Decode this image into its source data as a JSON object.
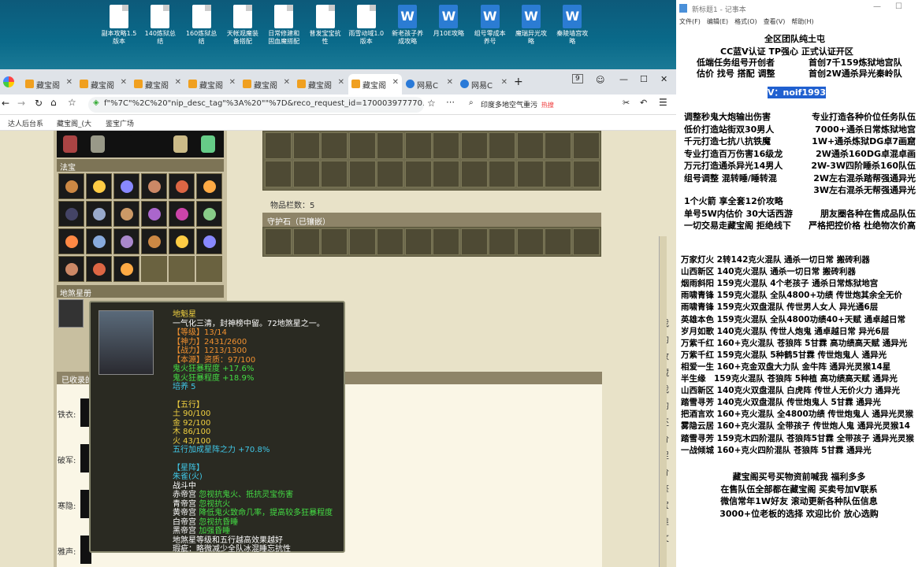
{
  "desktop": {
    "icons": [
      {
        "label": "副本攻略1.5版本",
        "type": "doc"
      },
      {
        "label": "140炼狱总结",
        "type": "doc"
      },
      {
        "label": "160炼狱总结",
        "type": "doc"
      },
      {
        "label": "天帐观魔装备搭配",
        "type": "doc"
      },
      {
        "label": "日常修建和固血魔搭配",
        "type": "doc"
      },
      {
        "label": "普发宝宝抗性",
        "type": "doc"
      },
      {
        "label": "雨雪动域1.0版本",
        "type": "doc"
      },
      {
        "label": "新老孩子养成攻略",
        "type": "word"
      },
      {
        "label": "月10E攻略",
        "type": "word"
      },
      {
        "label": "组号零成本养号",
        "type": "word"
      },
      {
        "label": "魔瑞异光攻略",
        "type": "word"
      },
      {
        "label": "秦陵墙宫攻略",
        "type": "word"
      }
    ]
  },
  "browser": {
    "tabs": [
      "藏宝阁",
      "藏宝阁",
      "藏宝阁",
      "藏宝阁",
      "藏宝阁",
      "藏宝阁",
      "藏宝阁",
      "网易C",
      "网易C"
    ],
    "tab_counter": "9",
    "url": "f\"%7C\"%2C%20\"nip_desc_tag\"%3A%20\"\"%7D&reco_request_id=1700039777701DS9mY",
    "search_placeholder": "印度多地空气重污",
    "search_badge": "热搜",
    "bookmarks": [
      "达人后台系",
      "藏宝阁_(大",
      "鉴宝广场"
    ]
  },
  "game": {
    "section_fabao": "法宝",
    "section_disha": "地煞星册",
    "section_collected": "已收录的",
    "item_count_label": "物品栏数：5",
    "guardian_label": "守护石（已镶嵌）",
    "side_labels": [
      "铁衣:",
      "破军:",
      "寒隐:",
      "雅声:"
    ],
    "right_sidebar_chars": [
      "我",
      "的",
      "收",
      "藏",
      "我",
      "的",
      "还",
      "价",
      "促",
      "价",
      "鉴",
      "宝",
      "推",
      "文"
    ]
  },
  "tooltip": {
    "name": "地魁星",
    "desc": "一气化三清，封神榜中留。72地煞星之一。",
    "level": "【等级】13/14",
    "shenli": "【神力】2431/2600",
    "zhanli": "【战力】1213/1300",
    "zizhi": "【本源】资质：97/100",
    "stat1": "鬼火狂暴程度 +17.6%",
    "stat2": "鬼火狂暴程度 +18.9%",
    "peiyang": "培养 5",
    "wuxing_title": "【五行】",
    "tu": "土 90/100",
    "jin": "金 92/100",
    "mu": "木 86/100",
    "huo": "火 43/100",
    "wuxing_bonus": "五行加成星阵之力 +70.8%",
    "xingzhen_title": "【星阵】",
    "xingzhen_name": "朱雀(火)",
    "zhandouzhong": "战斗中",
    "chidi_k": "赤帝宫",
    "chidi_v": "忽视抗鬼火、抵抗灵宝伤害",
    "qingdi_k": "青帝宫",
    "qingdi_v": "忽视抗火",
    "huangdi_k": "黄帝宫",
    "huangdi_v": "降低鬼火致命几率，提高较多狂暴程度",
    "baidi_k": "白帝宫",
    "baidi_v": "忽视抗昏睡",
    "heidi_k": "黑帝宫",
    "heidi_v": "加强昏睡",
    "note1": "地煞星等级和五行越高效果越好",
    "note2": "瑕疵：略微减少全队冰混睡忘抗性"
  },
  "notepad": {
    "title": "新标题1 - 记事本",
    "menu": [
      "文件(F)",
      "编辑(E)",
      "格式(O)",
      "查看(V)",
      "帮助(H)"
    ],
    "head": [
      "全区团队纯土屯",
      "CC蓝V认证 TP强心 正式认证开区",
      "低端任务组号开创者",
      "首创7千159炼狱地宫队",
      "估价 找号 搭配 调整",
      "首创2W通杀异光秦岭队"
    ],
    "contact": "V：noif1993",
    "services_left": [
      "调整秒鬼大炮输出伤害",
      "低价打造站街双30男人",
      "千元打造七抗八抗铁魔",
      "专业打造百万伤害16级龙",
      "万元打造通杀异光14男人",
      "组号调整 混转睡/睡转混"
    ],
    "services_right": [
      "专业打造各种价位任务队伍",
      "7000+通杀日常炼狱地宫",
      "1W+通杀炼狱DG卓7画窟",
      "2W通杀160DG卓混卓画",
      "2W-3W四阶睡杀160队伍",
      "2W左右混杀踏帮强通异光",
      "3W左右混杀无帮强通异光"
    ],
    "misc": [
      {
        "l": "1个火箭 享全套12价攻略",
        "r": ""
      },
      {
        "l": "单号5W内估价 30大话西游",
        "r": "朋友圈各种在售成品队伍"
      },
      {
        "l": "一切交易走藏宝阁 拒绝线下",
        "r": "严格把控价格 杜绝物次价高"
      }
    ],
    "teams": [
      "万家灯火 2转142克火混队 通杀一切日常 搬砖利器",
      "山西新区 140克火混队 通杀一切日常 搬砖利器",
      "烟雨斜阳 159克火混队 4个老孩子 通杀日常炼狱地宫",
      "雨啸青锋 159克火混队 全队4800+功绩 传世炮其余全无价",
      "雨啸青锋 159克火双盘混队 传世男人女人 异光通6层",
      "英雄本色 159克火混队 全队4800功绩40+天赋 通卓越日常",
      "岁月如歌 140克火混队 传世人炮鬼 通卓越日常 异光6层",
      "万紫千红 160+克火混队 苍狼阵 5甘霖 高功绩高天赋 通异光",
      "万紫千红 159克火混队 5种鹤5甘霖 传世炮鬼人 通异光",
      "相爱一生 160+克金双盘大力队 金牛阵 通异光灵猴14星",
      "半生缘　159克火混队 苍狼阵 5种植 高功绩高天赋 通异光",
      "山西新区 140克火双盘混队 白虎阵 传世人无价火力 通异光",
      "踏雪寻芳 140克火双盘混队 传世炮鬼人 5甘霖 通异光",
      "把酒言欢 160+克火混队 全4800功绩 传世炮鬼人 通异光灵猴",
      "雾隐云居 160+克火混队 全带孩子 传世炮人鬼 通异光灵猴14",
      "踏雪寻芳 159克木四阶混队 苍狼阵5甘霖 全带孩子 通异光灵猴",
      "一战倾城 160+克火四阶混队 苍狼阵 5甘霖 通异光"
    ],
    "footer": [
      "藏宝阁买号买物资前喊我 福利多多",
      "在售队伍全部都在藏宝阁 买卖号加V联系",
      "微信常年1W好友 滚动更新各种队伍信息",
      "3000+位老板的选择 欢迎比价 放心选购"
    ]
  }
}
